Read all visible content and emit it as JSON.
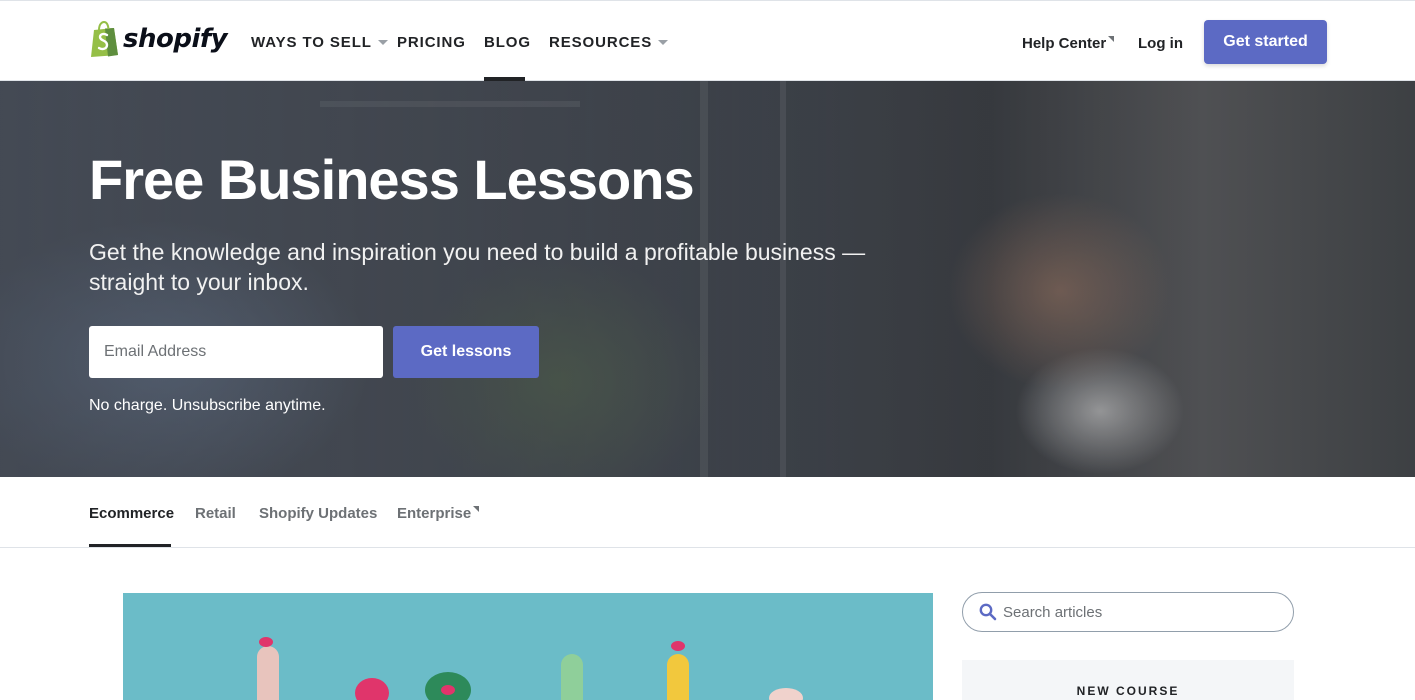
{
  "brand": {
    "name": "shopify",
    "logo_color": "#95bf47"
  },
  "nav": {
    "items": [
      {
        "label": "WAYS TO SELL",
        "has_dropdown": true
      },
      {
        "label": "PRICING",
        "has_dropdown": false
      },
      {
        "label": "BLOG",
        "has_dropdown": false,
        "active": true
      },
      {
        "label": "RESOURCES",
        "has_dropdown": true
      }
    ],
    "help_center": "Help Center",
    "login": "Log in",
    "cta": "Get started"
  },
  "hero": {
    "title": "Free Business Lessons",
    "subtitle": "Get the knowledge and inspiration you need to build a profitable business — straight to your inbox.",
    "email_placeholder": "Email Address",
    "submit": "Get lessons",
    "note": "No charge. Unsubscribe anytime."
  },
  "categories": {
    "tabs": [
      {
        "label": "Ecommerce",
        "active": true
      },
      {
        "label": "Retail",
        "active": false
      },
      {
        "label": "Shopify Updates",
        "active": false
      },
      {
        "label": "Enterprise",
        "active": false,
        "external": true
      }
    ]
  },
  "sidebar": {
    "search_placeholder": "Search articles",
    "course_label": "NEW COURSE"
  },
  "colors": {
    "accent": "#5c6ac4",
    "text": "#212326",
    "muted": "#6d7175"
  }
}
